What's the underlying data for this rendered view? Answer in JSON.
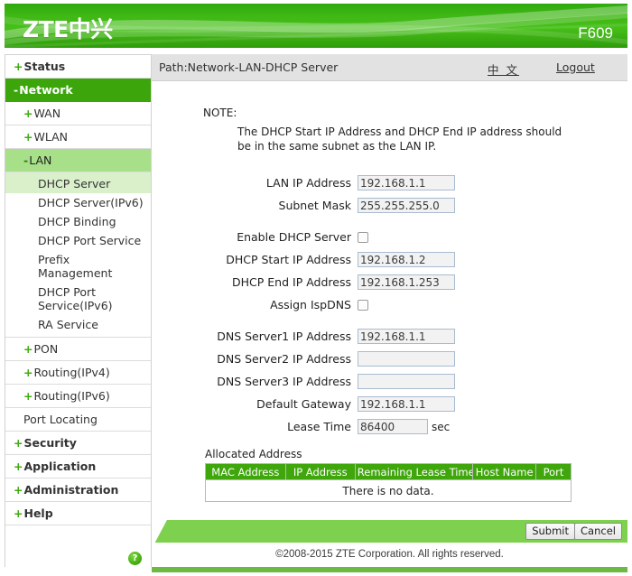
{
  "banner": {
    "logo": "ZTE中兴",
    "model": "F609"
  },
  "pathbar": {
    "path": "Path:Network-LAN-DHCP Server",
    "language_link": "中 文",
    "logout_link": "Logout"
  },
  "sidebar": {
    "items": [
      {
        "label": "Status",
        "sign": "+",
        "level": 0,
        "state": "normal"
      },
      {
        "label": "Network",
        "sign": "-",
        "level": 0,
        "state": "selected-dark"
      },
      {
        "label": "WAN",
        "sign": "+",
        "level": 1,
        "state": "normal"
      },
      {
        "label": "WLAN",
        "sign": "+",
        "level": 1,
        "state": "normal"
      },
      {
        "label": "LAN",
        "sign": "-",
        "level": 1,
        "state": "selected-mid"
      },
      {
        "label": "DHCP Server",
        "sign": "",
        "level": 2,
        "state": "selected-light"
      },
      {
        "label": "DHCP Server(IPv6)",
        "sign": "",
        "level": 2,
        "state": "normal"
      },
      {
        "label": "DHCP Binding",
        "sign": "",
        "level": 2,
        "state": "normal"
      },
      {
        "label": "DHCP Port Service",
        "sign": "",
        "level": 2,
        "state": "normal"
      },
      {
        "label": "Prefix Management",
        "sign": "",
        "level": 2,
        "state": "normal"
      },
      {
        "label": "DHCP Port Service(IPv6)",
        "sign": "",
        "level": 2,
        "state": "normal"
      },
      {
        "label": "RA Service",
        "sign": "",
        "level": 2,
        "state": "normal"
      },
      {
        "label": "PON",
        "sign": "+",
        "level": 1,
        "state": "normal"
      },
      {
        "label": "Routing(IPv4)",
        "sign": "+",
        "level": 1,
        "state": "normal"
      },
      {
        "label": "Routing(IPv6)",
        "sign": "+",
        "level": 1,
        "state": "normal"
      },
      {
        "label": "Port Locating",
        "sign": "",
        "level": 1,
        "state": "normal"
      },
      {
        "label": "Security",
        "sign": "+",
        "level": 0,
        "state": "normal"
      },
      {
        "label": "Application",
        "sign": "+",
        "level": 0,
        "state": "normal"
      },
      {
        "label": "Administration",
        "sign": "+",
        "level": 0,
        "state": "normal"
      },
      {
        "label": "Help",
        "sign": "+",
        "level": 0,
        "state": "normal"
      }
    ],
    "help_icon": "?"
  },
  "note": {
    "label": "NOTE:",
    "text": "The DHCP Start IP Address and DHCP End IP address should be in the same subnet as the LAN IP."
  },
  "form": {
    "fields": [
      {
        "label": "LAN IP Address",
        "type": "text",
        "value": "192.168.1.1",
        "placeholder": ""
      },
      {
        "label": "Subnet Mask",
        "type": "text",
        "value": "255.255.255.0",
        "placeholder": ""
      },
      {
        "label": "Enable DHCP Server",
        "type": "checkbox",
        "value": "",
        "checked": false
      },
      {
        "label": "DHCP Start IP Address",
        "type": "text",
        "value": "192.168.1.2",
        "placeholder": ""
      },
      {
        "label": "DHCP End IP Address",
        "type": "text",
        "value": "192.168.1.253",
        "placeholder": ""
      },
      {
        "label": "Assign IspDNS",
        "type": "checkbox",
        "value": "",
        "checked": false
      },
      {
        "label": "DNS Server1 IP Address",
        "type": "text",
        "value": "192.168.1.1",
        "placeholder": ""
      },
      {
        "label": "DNS Server2 IP Address",
        "type": "text",
        "value": "",
        "placeholder": ""
      },
      {
        "label": "DNS Server3 IP Address",
        "type": "text",
        "value": "",
        "placeholder": ""
      },
      {
        "label": "Default Gateway",
        "type": "text",
        "value": "192.168.1.1",
        "placeholder": ""
      },
      {
        "label": "Lease Time",
        "type": "text",
        "value": "86400",
        "placeholder": "",
        "unit": "sec"
      }
    ]
  },
  "allocated": {
    "title": "Allocated Address",
    "columns": [
      "MAC Address",
      "IP Address",
      "Remaining Lease Time",
      "Host Name",
      "Port"
    ],
    "empty_text": "There is no data.",
    "rows": []
  },
  "footer": {
    "submit_label": "Submit",
    "cancel_label": "Cancel",
    "copyright": "©2008-2015 ZTE Corporation. All rights reserved."
  },
  "colors": {
    "brand_green": "#3ba50b",
    "banner_green": "#3fb715",
    "table_header_green": "#3fa60c",
    "footer_green": "#7ed14e",
    "selected_mid": "#a8e08a",
    "selected_light": "#d9f0cb"
  }
}
